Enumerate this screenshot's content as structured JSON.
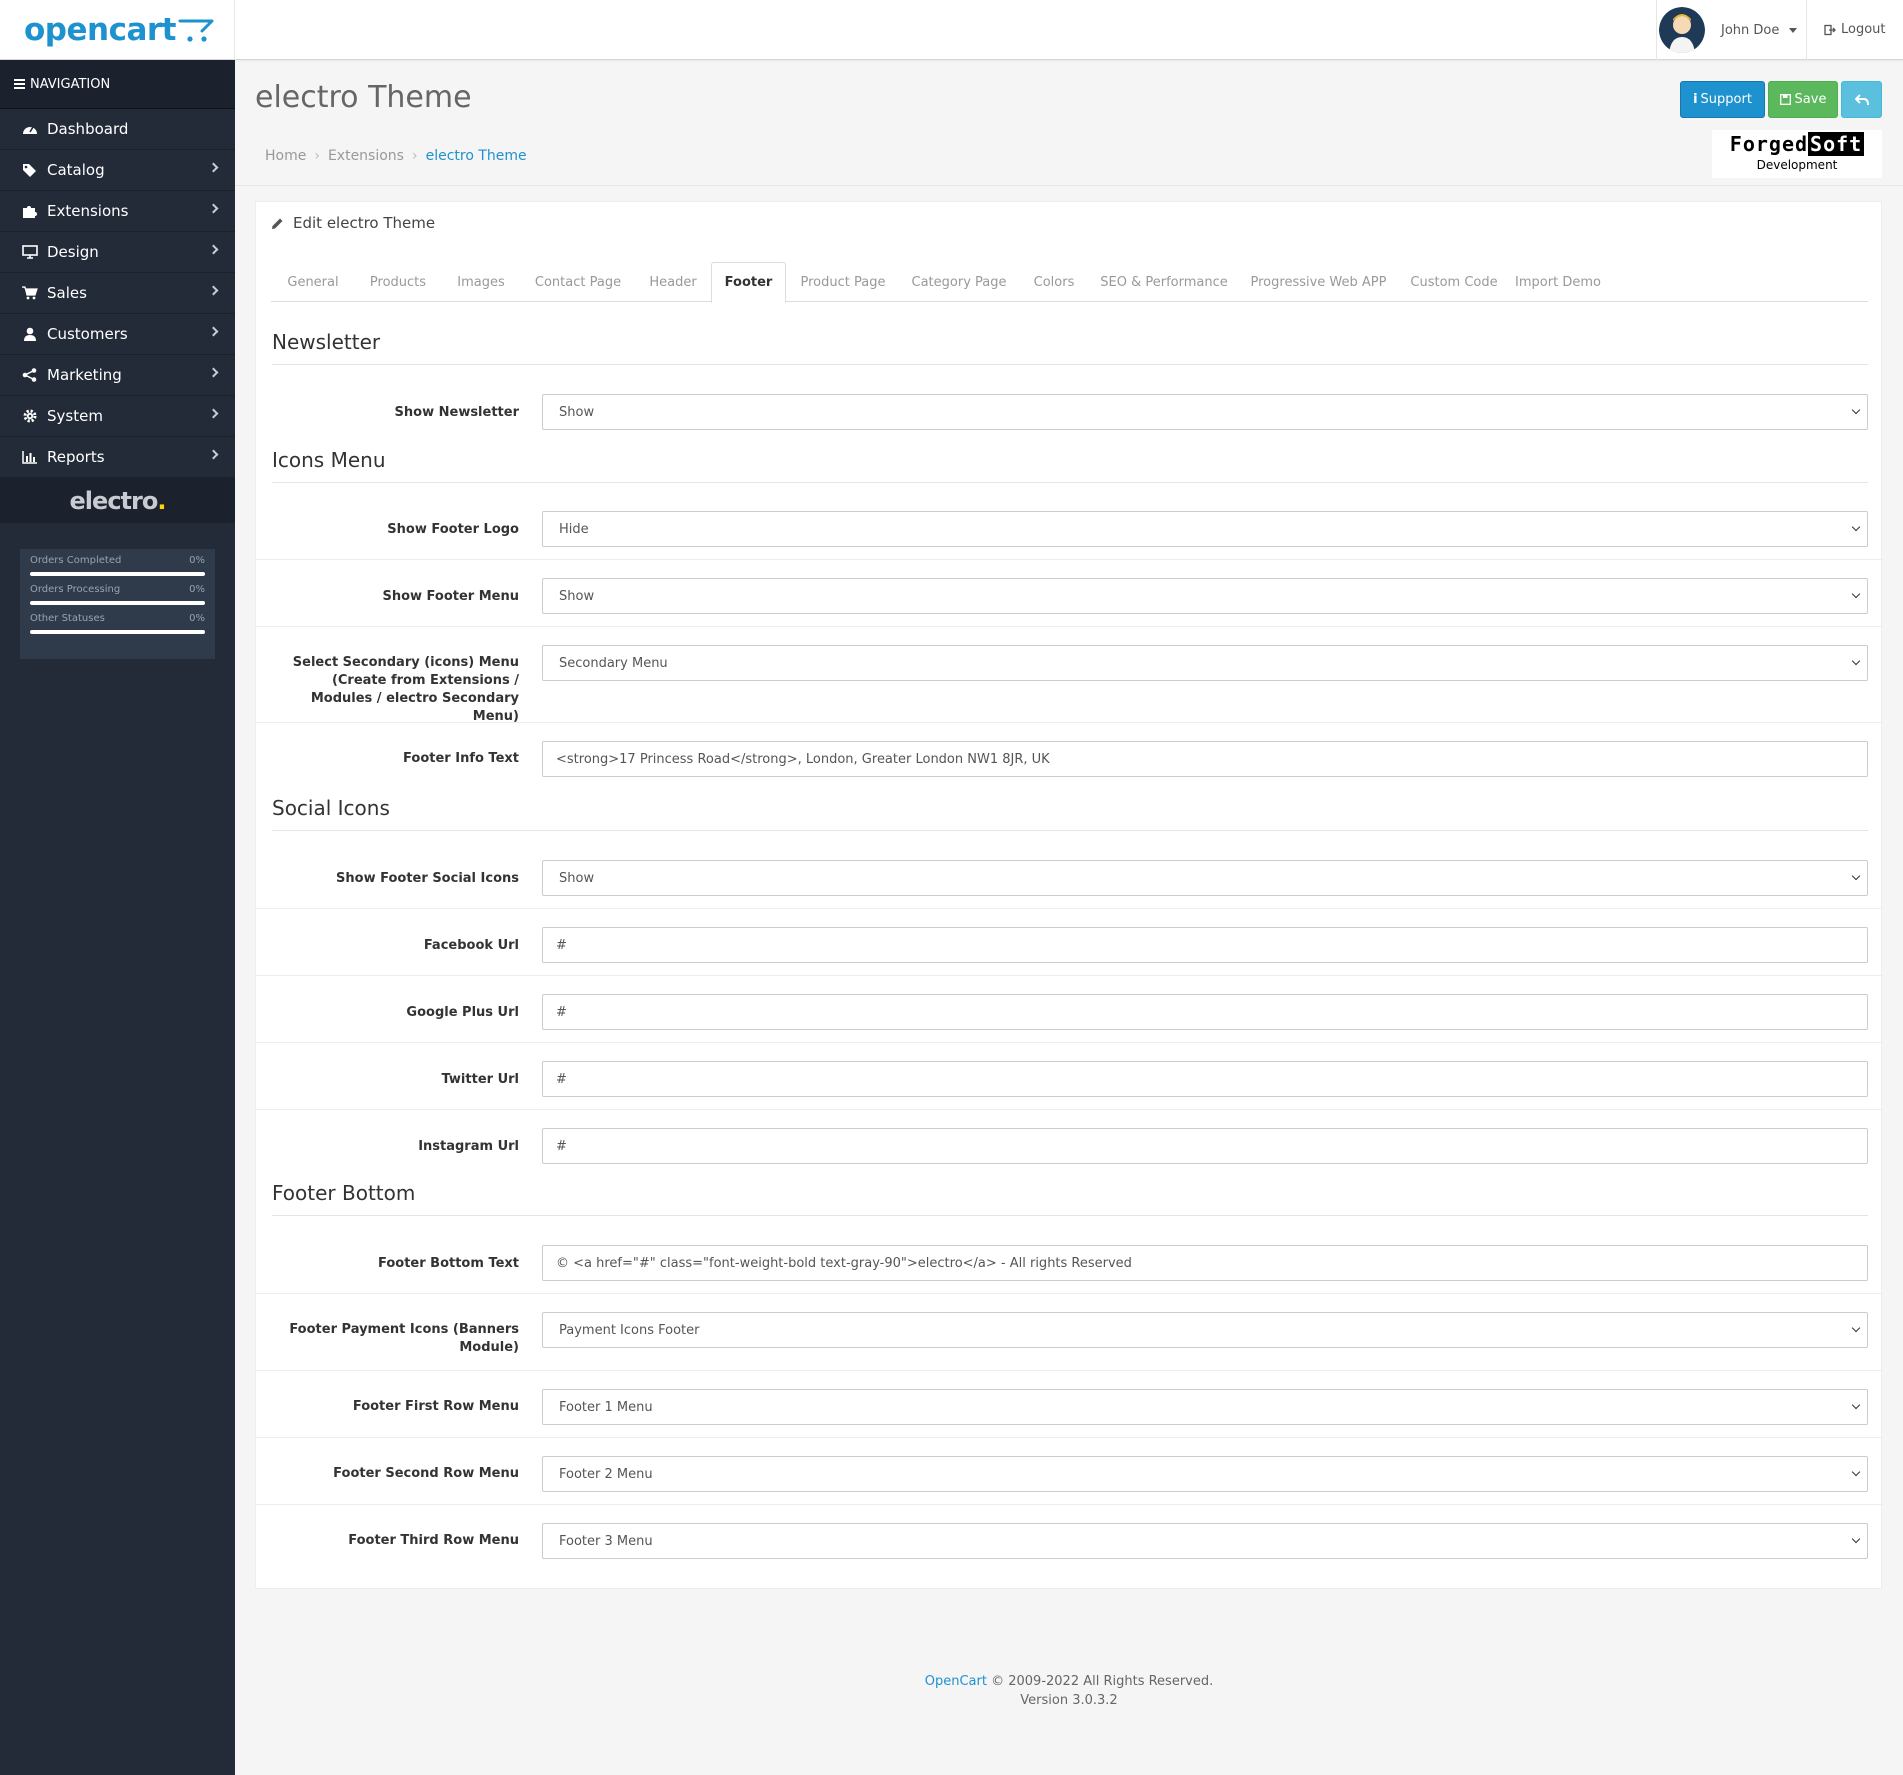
{
  "header": {
    "logo_text": "opencart",
    "user_name": "John Doe",
    "logout_label": "Logout"
  },
  "sidebar": {
    "nav_title": "NAVIGATION",
    "items": [
      {
        "label": "Dashboard",
        "icon": "dashboard-icon"
      },
      {
        "label": "Catalog",
        "icon": "tags-icon"
      },
      {
        "label": "Extensions",
        "icon": "puzzle-icon"
      },
      {
        "label": "Design",
        "icon": "desktop-icon"
      },
      {
        "label": "Sales",
        "icon": "cart-icon"
      },
      {
        "label": "Customers",
        "icon": "user-icon"
      },
      {
        "label": "Marketing",
        "icon": "share-icon"
      },
      {
        "label": "System",
        "icon": "gear-icon"
      },
      {
        "label": "Reports",
        "icon": "bar-chart-icon"
      }
    ],
    "brand_logo": "electro",
    "brand_dot": ".",
    "stats": [
      {
        "label": "Orders Completed",
        "value": "0%"
      },
      {
        "label": "Orders Processing",
        "value": "0%"
      },
      {
        "label": "Other Statuses",
        "value": "0%"
      }
    ]
  },
  "page": {
    "title": "electro Theme",
    "breadcrumb": [
      "Home",
      "Extensions",
      "electro Theme"
    ],
    "support_label": "Support",
    "save_label": "Save",
    "vendor_logo_a": "Forged",
    "vendor_logo_b": "Soft",
    "vendor_sub": "Development"
  },
  "panel": {
    "heading": "Edit electro Theme",
    "tabs": [
      "General",
      "Products",
      "Images",
      "Contact Page",
      "Header",
      "Footer",
      "Product Page",
      "Category Page",
      "Colors",
      "SEO & Performance",
      "Progressive Web APP",
      "Custom Code",
      "Import Demo"
    ],
    "active_tab": "Footer",
    "sections": {
      "newsletter": "Newsletter",
      "icons_menu": "Icons Menu",
      "social_icons": "Social Icons",
      "footer_bottom": "Footer Bottom"
    },
    "fields": {
      "show_newsletter": {
        "label": "Show Newsletter",
        "value": "Show"
      },
      "show_footer_logo": {
        "label": "Show Footer Logo",
        "value": "Hide"
      },
      "show_footer_menu": {
        "label": "Show Footer Menu",
        "value": "Show"
      },
      "secondary_menu": {
        "label": "Select Secondary (icons) Menu (Create from Extensions / Modules / electro Secondary Menu)",
        "value": "Secondary Menu"
      },
      "footer_info_text": {
        "label": "Footer Info Text",
        "value": "<strong>17 Princess Road</strong>, London, Greater London NW1 8JR, UK"
      },
      "show_social_icons": {
        "label": "Show Footer Social Icons",
        "value": "Show"
      },
      "facebook_url": {
        "label": "Facebook Url",
        "value": "#"
      },
      "google_plus_url": {
        "label": "Google Plus Url",
        "value": "#"
      },
      "twitter_url": {
        "label": "Twitter Url",
        "value": "#"
      },
      "instagram_url": {
        "label": "Instagram Url",
        "value": "#"
      },
      "footer_bottom_text": {
        "label": "Footer Bottom Text",
        "value": "© <a href=\"#\" class=\"font-weight-bold text-gray-90\">electro</a> - All rights Reserved"
      },
      "payment_icons": {
        "label": "Footer Payment Icons (Banners Module)",
        "value": "Payment Icons Footer"
      },
      "first_row_menu": {
        "label": "Footer First Row Menu",
        "value": "Footer 1 Menu"
      },
      "second_row_menu": {
        "label": "Footer Second Row Menu",
        "value": "Footer 2 Menu"
      },
      "third_row_menu": {
        "label": "Footer Third Row Menu",
        "value": "Footer 3 Menu"
      }
    }
  },
  "footer": {
    "brand": "OpenCart",
    "copyright": " © 2009-2022 All Rights Reserved.",
    "version": "Version 3.0.3.2"
  },
  "colors": {
    "accent": "#1e91cf",
    "sidebar_bg": "#232b38",
    "save_green": "#5cb85c",
    "back_cyan": "#5bc0de"
  }
}
